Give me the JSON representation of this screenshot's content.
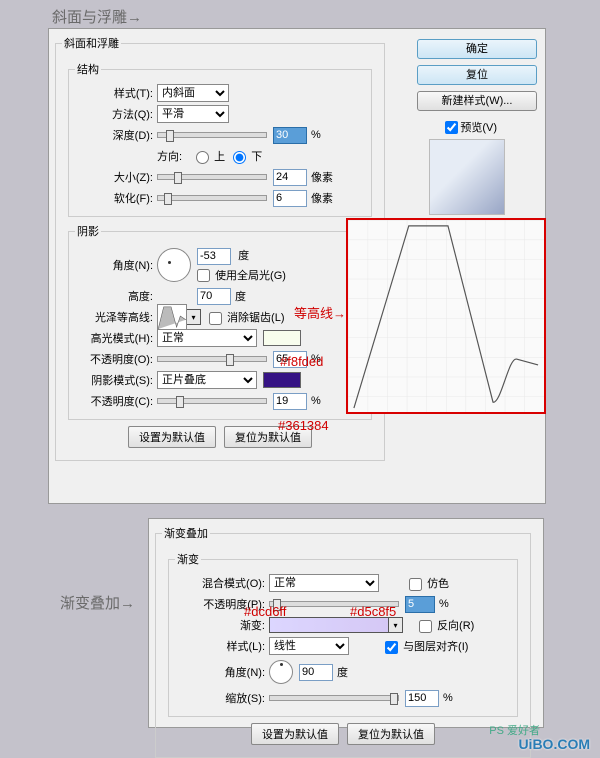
{
  "outer_labels": {
    "bevel": "斜面与浮雕→",
    "gradient": "渐变叠加→"
  },
  "main": {
    "title": "斜面和浮雕",
    "structure_title": "结构",
    "style_label": "样式(T):",
    "style_value": "内斜面",
    "method_label": "方法(Q):",
    "method_value": "平滑",
    "depth_label": "深度(D):",
    "depth_value": "30",
    "depth_unit": "%",
    "direction_label": "方向:",
    "dir_up": "上",
    "dir_down": "下",
    "size_label": "大小(Z):",
    "size_value": "24",
    "size_unit": "像素",
    "soften_label": "软化(F):",
    "soften_value": "6",
    "soften_unit": "像素",
    "shadow_title": "阴影",
    "angle_label": "角度(N):",
    "angle_value": "-53",
    "angle_unit": "度",
    "global_light": "使用全局光(G)",
    "altitude_label": "高度:",
    "altitude_value": "70",
    "altitude_unit": "度",
    "gloss_label": "光泽等高线:",
    "antialias": "消除锯齿(L)",
    "highlight_mode_label": "高光模式(H):",
    "highlight_mode_value": "正常",
    "highlight_opacity_label": "不透明度(O):",
    "highlight_opacity_value": "65",
    "highlight_opacity_unit": "%",
    "shadow_mode_label": "阴影模式(S):",
    "shadow_mode_value": "正片叠底",
    "shadow_opacity_label": "不透明度(C):",
    "shadow_opacity_value": "19",
    "shadow_opacity_unit": "%",
    "set_default": "设置为默认值",
    "reset_default": "复位为默认值"
  },
  "side": {
    "ok": "确定",
    "reset": "复位",
    "new_style": "新建样式(W)...",
    "preview": "预览(V)"
  },
  "annotations": {
    "contour": "等高线→",
    "highlight_color": "#f8fded",
    "shadow_color": "#361384",
    "grad_left": "#dcd6ff",
    "grad_right": "#d5c8f5"
  },
  "gradient": {
    "title": "渐变叠加",
    "sub": "渐变",
    "blend_label": "混合模式(O):",
    "blend_value": "正常",
    "dither": "仿色",
    "opacity_label": "不透明度(P):",
    "opacity_value": "5",
    "opacity_unit": "%",
    "gradient_label": "渐变:",
    "reverse": "反向(R)",
    "style_label": "样式(L):",
    "style_value": "线性",
    "align": "与图层对齐(I)",
    "angle_label": "角度(N):",
    "angle_value": "90",
    "angle_unit": "度",
    "scale_label": "缩放(S):",
    "scale_value": "150",
    "scale_unit": "%",
    "set_default": "设置为默认值",
    "reset_default": "复位为默认值"
  },
  "watermark": "UiBO.COM",
  "watermark2": "PS 爱好者"
}
